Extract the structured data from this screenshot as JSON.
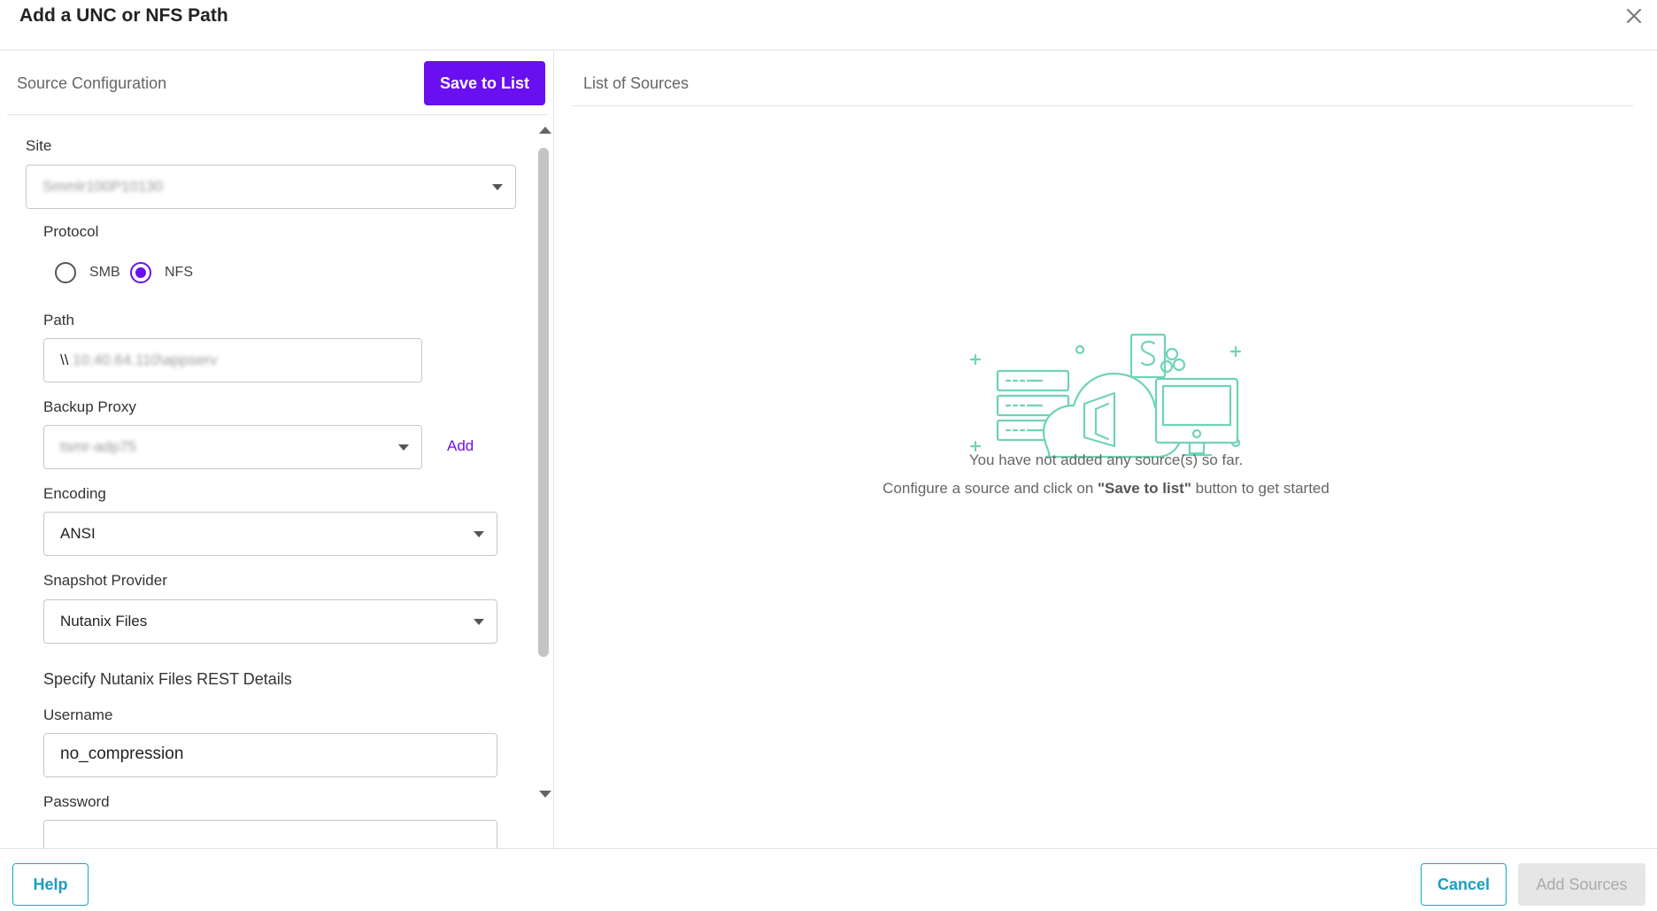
{
  "dialog": {
    "title": "Add a UNC or NFS Path"
  },
  "left_panel": {
    "title": "Source Configuration",
    "save_label": "Save to List",
    "site": {
      "label": "Site",
      "value": "Smmlr100P10130"
    },
    "protocol": {
      "label": "Protocol",
      "options": [
        {
          "label": "SMB",
          "selected": false
        },
        {
          "label": "NFS",
          "selected": true
        }
      ]
    },
    "path": {
      "label": "Path",
      "prefix": "\\\\",
      "value": "10.40.64.110\\appserv"
    },
    "backup_proxy": {
      "label": "Backup Proxy",
      "value": "tsmr-adp75",
      "add_label": "Add"
    },
    "encoding": {
      "label": "Encoding",
      "value": "ANSI"
    },
    "snapshot_provider": {
      "label": "Snapshot Provider",
      "value": "Nutanix Files"
    },
    "rest_details_heading": "Specify Nutanix Files REST Details",
    "username": {
      "label": "Username",
      "value": "no_compression"
    },
    "password": {
      "label": "Password",
      "value": ""
    }
  },
  "right_panel": {
    "title": "List of Sources",
    "empty_line1": "You have not added any source(s) so far.",
    "empty_line2_prefix": "Configure a source and click on ",
    "empty_line2_bold": "\"Save to list\"",
    "empty_line2_suffix": " button to get started"
  },
  "footer": {
    "help_label": "Help",
    "cancel_label": "Cancel",
    "add_sources_label": "Add Sources"
  },
  "colors": {
    "primary": "#6a0ff0",
    "secondary": "#1aa5c8",
    "illustration": "#6fd3b8"
  }
}
